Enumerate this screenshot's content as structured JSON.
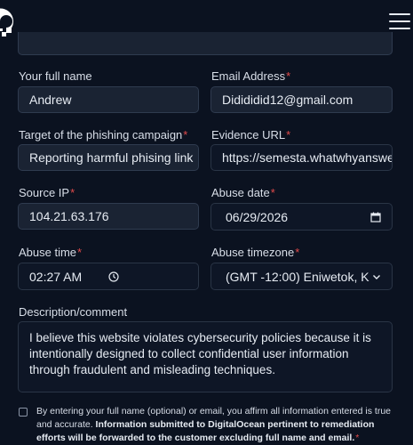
{
  "form": {
    "full_name": {
      "label": "Your full name",
      "value": "Andrew"
    },
    "email": {
      "label": "Email Address",
      "value": "Didididid12@gmail.com"
    },
    "target": {
      "label": "Target of the phishing campaign",
      "value": "Reporting harmful phising link"
    },
    "evidence_url": {
      "label": "Evidence URL",
      "value": "https://semesta.whatwhyanswer"
    },
    "source_ip": {
      "label": "Source IP",
      "value": "104.21.63.176"
    },
    "abuse_date": {
      "label": "Abuse date",
      "value": "06/29/2026"
    },
    "abuse_time": {
      "label": "Abuse time",
      "value": "02:27 AM"
    },
    "abuse_timezone": {
      "label": "Abuse timezone",
      "value": "(GMT -12:00) Eniwetok, K"
    },
    "description": {
      "label": "Description/comment",
      "value": "I believe this website violates cybersecurity policies because it is intentionally designed to collect confidential user information through fraudulent and misleading techniques."
    },
    "required_mark": "*",
    "consent": {
      "text": "By entering your full name (optional) or email, you affirm all information entered is true and accurate. ",
      "bold": "Information submitted to DigitalOcean pertinent to remediation efforts will be forwarded to the customer excluding full name and email.",
      "required_mark": "*"
    }
  },
  "icons": {
    "logo": "digitalocean-logo",
    "menu": "hamburger-menu-icon",
    "calendar": "calendar-icon",
    "clock": "clock-icon",
    "dropdown": "chevron-down-icon"
  },
  "colors": {
    "background": "#0b1220",
    "input_background": "#1a2333",
    "required": "#e14b4b",
    "text": "#e6ebf2"
  }
}
